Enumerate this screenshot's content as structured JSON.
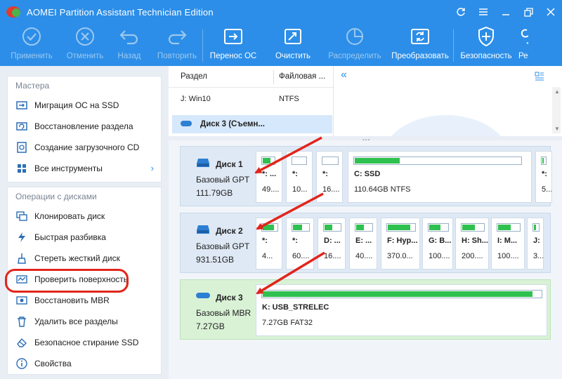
{
  "app": {
    "title": "AOMEI Partition Assistant Technician Edition"
  },
  "window_controls": [
    "refresh-icon",
    "menu-icon",
    "minimize-icon",
    "restore-icon",
    "close-icon"
  ],
  "toolbar": [
    {
      "label": "Применить",
      "icon": "check-icon",
      "disabled": true
    },
    {
      "label": "Отменить",
      "icon": "cancel-icon",
      "disabled": true
    },
    {
      "label": "Назад",
      "icon": "undo-icon",
      "disabled": true
    },
    {
      "label": "Повторить",
      "icon": "redo-icon",
      "disabled": true
    },
    {
      "label": "Перенос ОС",
      "icon": "migrate-os-icon",
      "disabled": false
    },
    {
      "label": "Очистить",
      "icon": "clean-icon",
      "disabled": false
    },
    {
      "label": "Распределить",
      "icon": "allocate-icon",
      "disabled": true
    },
    {
      "label": "Преобразовать",
      "icon": "convert-icon",
      "disabled": false
    },
    {
      "label": "Безопасность",
      "icon": "shield-icon",
      "disabled": false
    },
    {
      "label": "Ре",
      "icon": "more-icon",
      "disabled": false
    }
  ],
  "sidebar": {
    "wizards": {
      "title": "Мастера",
      "items": [
        {
          "label": "Миграция ОС на SSD",
          "icon": "os-migrate-icon"
        },
        {
          "label": "Восстановление раздела",
          "icon": "partition-recovery-icon"
        },
        {
          "label": "Создание загрузочного CD",
          "icon": "bootable-cd-icon"
        },
        {
          "label": "Все инструменты",
          "icon": "tools-icon",
          "chevron": "›"
        }
      ]
    },
    "disk_ops": {
      "title": "Операции с дисками",
      "items": [
        {
          "label": "Клонировать диск",
          "icon": "clone-disk-icon"
        },
        {
          "label": "Быстрая разбивка",
          "icon": "quick-partition-icon"
        },
        {
          "label": "Стереть жесткий диск",
          "icon": "wipe-disk-icon"
        },
        {
          "label": "Проверить поверхность",
          "icon": "surface-test-icon"
        },
        {
          "label": "Восстановить MBR",
          "icon": "rebuild-mbr-icon"
        },
        {
          "label": "Удалить все разделы",
          "icon": "delete-partitions-icon"
        },
        {
          "label": "Безопасное стирание SSD",
          "icon": "ssd-erase-icon"
        },
        {
          "label": "Свойства",
          "icon": "info-icon"
        }
      ]
    }
  },
  "table": {
    "col_partition": "Раздел",
    "col_fs": "Файловая ...",
    "row1_partition": "J: Win10",
    "row1_fs": "NTFS",
    "selected_disk": "Диск 3 (Съемн...",
    "collapse": "«"
  },
  "disks": [
    {
      "name": "Диск 1",
      "type": "Базовый GPT",
      "size": "111.79GB",
      "usb": false,
      "partitions": [
        {
          "label": "*: ...",
          "info": "49....",
          "used": 0.7
        },
        {
          "label": "*:",
          "info": "10...",
          "used": 0.0
        },
        {
          "label": "*:",
          "info": "16....",
          "used": 0.0
        },
        {
          "label": "C: SSD",
          "info": "110.64GB NTFS",
          "used": 0.27
        },
        {
          "label": "*:",
          "info": "5...",
          "used": 0.4
        }
      ]
    },
    {
      "name": "Диск 2",
      "type": "Базовый GPT",
      "size": "931.51GB",
      "usb": false,
      "partitions": [
        {
          "label": "*:",
          "info": "4...",
          "used": 0.8
        },
        {
          "label": "*:",
          "info": "60....",
          "used": 0.6
        },
        {
          "label": "D: ...",
          "info": "16....",
          "used": 0.5
        },
        {
          "label": "E: ...",
          "info": "40....",
          "used": 0.5
        },
        {
          "label": "F: Hyp...",
          "info": "370.0...",
          "used": 0.85
        },
        {
          "label": "G: B...",
          "info": "100....",
          "used": 0.6
        },
        {
          "label": "H: Sh...",
          "info": "200....",
          "used": 0.6
        },
        {
          "label": "I: M...",
          "info": "100....",
          "used": 0.6
        },
        {
          "label": "J:",
          "info": "3...",
          "used": 0.5
        }
      ]
    },
    {
      "name": "Диск 3",
      "type": "Базовый MBR",
      "size": "7.27GB",
      "usb": true,
      "partitions": [
        {
          "label": "K: USB_STRELEC",
          "info": "7.27GB FAT32",
          "used": 0.97
        }
      ]
    }
  ],
  "colors": {
    "accent": "#2c8ee8",
    "used_fill": "#2fc14f",
    "annotation": "#e1251b"
  }
}
